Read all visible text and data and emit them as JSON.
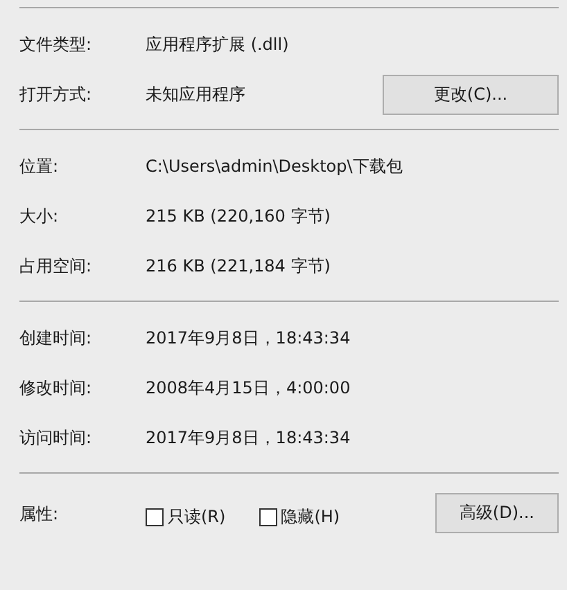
{
  "sections": [
    {
      "rows": [
        {
          "label": "文件类型:",
          "value": "应用程序扩展 (.dll)"
        },
        {
          "label": "打开方式:",
          "value": "未知应用程序",
          "button": "更改(C)..."
        }
      ]
    },
    {
      "rows": [
        {
          "label": "位置:",
          "value": "C:\\Users\\admin\\Desktop\\下载包"
        },
        {
          "label": "大小:",
          "value": "215 KB (220,160 字节)"
        },
        {
          "label": "占用空间:",
          "value": "216 KB (221,184 字节)"
        }
      ]
    },
    {
      "rows": [
        {
          "label": "创建时间:",
          "value": "2017年9月8日，18:43:34"
        },
        {
          "label": "修改时间:",
          "value": "2008年4月15日，4:00:00"
        },
        {
          "label": "访问时间:",
          "value": "2017年9月8日，18:43:34"
        }
      ]
    }
  ],
  "attributes": {
    "label": "属性:",
    "checkboxes": [
      {
        "label": "只读(R)",
        "checked": false
      },
      {
        "label": "隐藏(H)",
        "checked": false
      }
    ],
    "button": "高级(D)..."
  }
}
